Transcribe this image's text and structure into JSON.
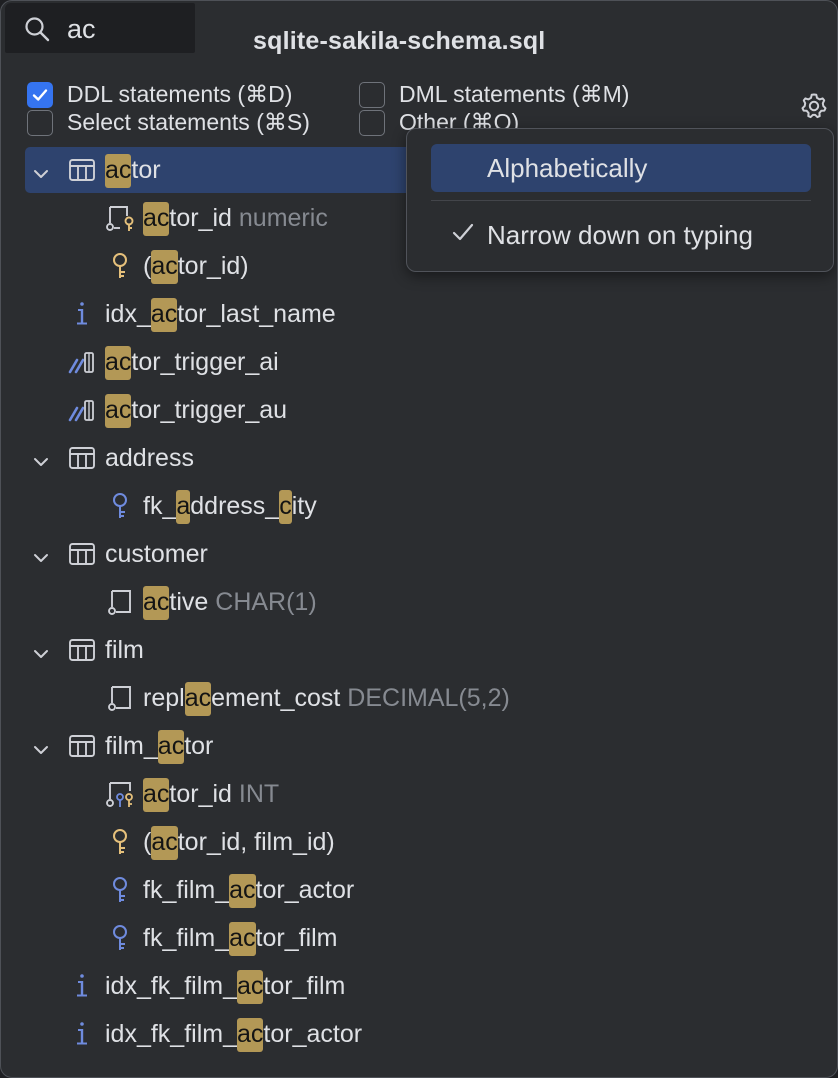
{
  "search": {
    "value": "ac"
  },
  "title": "sqlite-sakila-schema.sql",
  "filters": [
    {
      "label": "DDL statements (⌘D)",
      "checked": true
    },
    {
      "label": "DML statements (⌘M)",
      "checked": false
    },
    {
      "label": "Select statements (⌘S)",
      "checked": false
    },
    {
      "label": "Other (⌘O)",
      "checked": false
    }
  ],
  "popup": {
    "items": [
      {
        "label": "Alphabetically",
        "checked": false,
        "active": true
      },
      {
        "label": "Narrow down on typing",
        "checked": true,
        "active": false
      }
    ]
  },
  "colors": {
    "accent": "#3574f0",
    "selection": "#2e436e",
    "match_highlight": "#b39856",
    "muted_type": "#868a91",
    "index_icon": "#6f8bde",
    "primary_key_icon": "#e5c07b",
    "foreign_key_icon": "#6f8bde"
  },
  "tree": [
    {
      "indent": 0,
      "expandable": true,
      "icon": "table-icon",
      "segments": [
        [
          "ac",
          true
        ],
        [
          "tor",
          false
        ]
      ],
      "type": "",
      "selected": true
    },
    {
      "indent": 1,
      "expandable": false,
      "icon": "column-pk-icon",
      "segments": [
        [
          "ac",
          true
        ],
        [
          "tor_id",
          false
        ]
      ],
      "type": "numeric",
      "selected": false
    },
    {
      "indent": 1,
      "expandable": false,
      "icon": "primary-key-icon",
      "segments": [
        [
          "(",
          false
        ],
        [
          "ac",
          true
        ],
        [
          "tor_id)",
          false
        ]
      ],
      "type": "",
      "selected": false
    },
    {
      "indent": 0,
      "expandable": false,
      "icon": "index-icon",
      "segments": [
        [
          "idx_",
          false
        ],
        [
          "ac",
          true
        ],
        [
          "tor_last_name",
          false
        ]
      ],
      "type": "",
      "selected": false
    },
    {
      "indent": 0,
      "expandable": false,
      "icon": "trigger-icon",
      "segments": [
        [
          "ac",
          true
        ],
        [
          "tor_trigger_ai",
          false
        ]
      ],
      "type": "",
      "selected": false
    },
    {
      "indent": 0,
      "expandable": false,
      "icon": "trigger-icon",
      "segments": [
        [
          "ac",
          true
        ],
        [
          "tor_trigger_au",
          false
        ]
      ],
      "type": "",
      "selected": false
    },
    {
      "indent": 0,
      "expandable": true,
      "icon": "table-icon",
      "segments": [
        [
          "address",
          false
        ]
      ],
      "type": "",
      "selected": false
    },
    {
      "indent": 1,
      "expandable": false,
      "icon": "foreign-key-icon",
      "segments": [
        [
          "fk_",
          false
        ],
        [
          "a",
          true
        ],
        [
          "ddress_",
          false
        ],
        [
          "c",
          true
        ],
        [
          "ity",
          false
        ]
      ],
      "type": "",
      "selected": false
    },
    {
      "indent": 0,
      "expandable": true,
      "icon": "table-icon",
      "segments": [
        [
          "customer",
          false
        ]
      ],
      "type": "",
      "selected": false
    },
    {
      "indent": 1,
      "expandable": false,
      "icon": "column-icon",
      "segments": [
        [
          "ac",
          true
        ],
        [
          "tive",
          false
        ]
      ],
      "type": "CHAR(1)",
      "selected": false
    },
    {
      "indent": 0,
      "expandable": true,
      "icon": "table-icon",
      "segments": [
        [
          "film",
          false
        ]
      ],
      "type": "",
      "selected": false
    },
    {
      "indent": 1,
      "expandable": false,
      "icon": "column-icon",
      "segments": [
        [
          "repl",
          false
        ],
        [
          "ac",
          true
        ],
        [
          "ement_cost",
          false
        ]
      ],
      "type": "DECIMAL(5,2)",
      "selected": false
    },
    {
      "indent": 0,
      "expandable": true,
      "icon": "table-icon",
      "segments": [
        [
          "film_",
          false
        ],
        [
          "ac",
          true
        ],
        [
          "tor",
          false
        ]
      ],
      "type": "",
      "selected": false
    },
    {
      "indent": 1,
      "expandable": false,
      "icon": "column-fk-pk-icon",
      "segments": [
        [
          "ac",
          true
        ],
        [
          "tor_id",
          false
        ]
      ],
      "type": "INT",
      "selected": false
    },
    {
      "indent": 1,
      "expandable": false,
      "icon": "primary-key-icon",
      "segments": [
        [
          "(",
          false
        ],
        [
          "ac",
          true
        ],
        [
          "tor_id, film_id)",
          false
        ]
      ],
      "type": "",
      "selected": false
    },
    {
      "indent": 1,
      "expandable": false,
      "icon": "foreign-key-icon",
      "segments": [
        [
          "fk_film_",
          false
        ],
        [
          "ac",
          true
        ],
        [
          "tor_actor",
          false
        ]
      ],
      "type": "",
      "selected": false
    },
    {
      "indent": 1,
      "expandable": false,
      "icon": "foreign-key-icon",
      "segments": [
        [
          "fk_film_",
          false
        ],
        [
          "ac",
          true
        ],
        [
          "tor_film",
          false
        ]
      ],
      "type": "",
      "selected": false
    },
    {
      "indent": 0,
      "expandable": false,
      "icon": "index-icon",
      "segments": [
        [
          "idx_fk_film_",
          false
        ],
        [
          "ac",
          true
        ],
        [
          "tor_film",
          false
        ]
      ],
      "type": "",
      "selected": false
    },
    {
      "indent": 0,
      "expandable": false,
      "icon": "index-icon",
      "segments": [
        [
          "idx_fk_film_",
          false
        ],
        [
          "ac",
          true
        ],
        [
          "tor_actor",
          false
        ]
      ],
      "type": "",
      "selected": false
    }
  ]
}
